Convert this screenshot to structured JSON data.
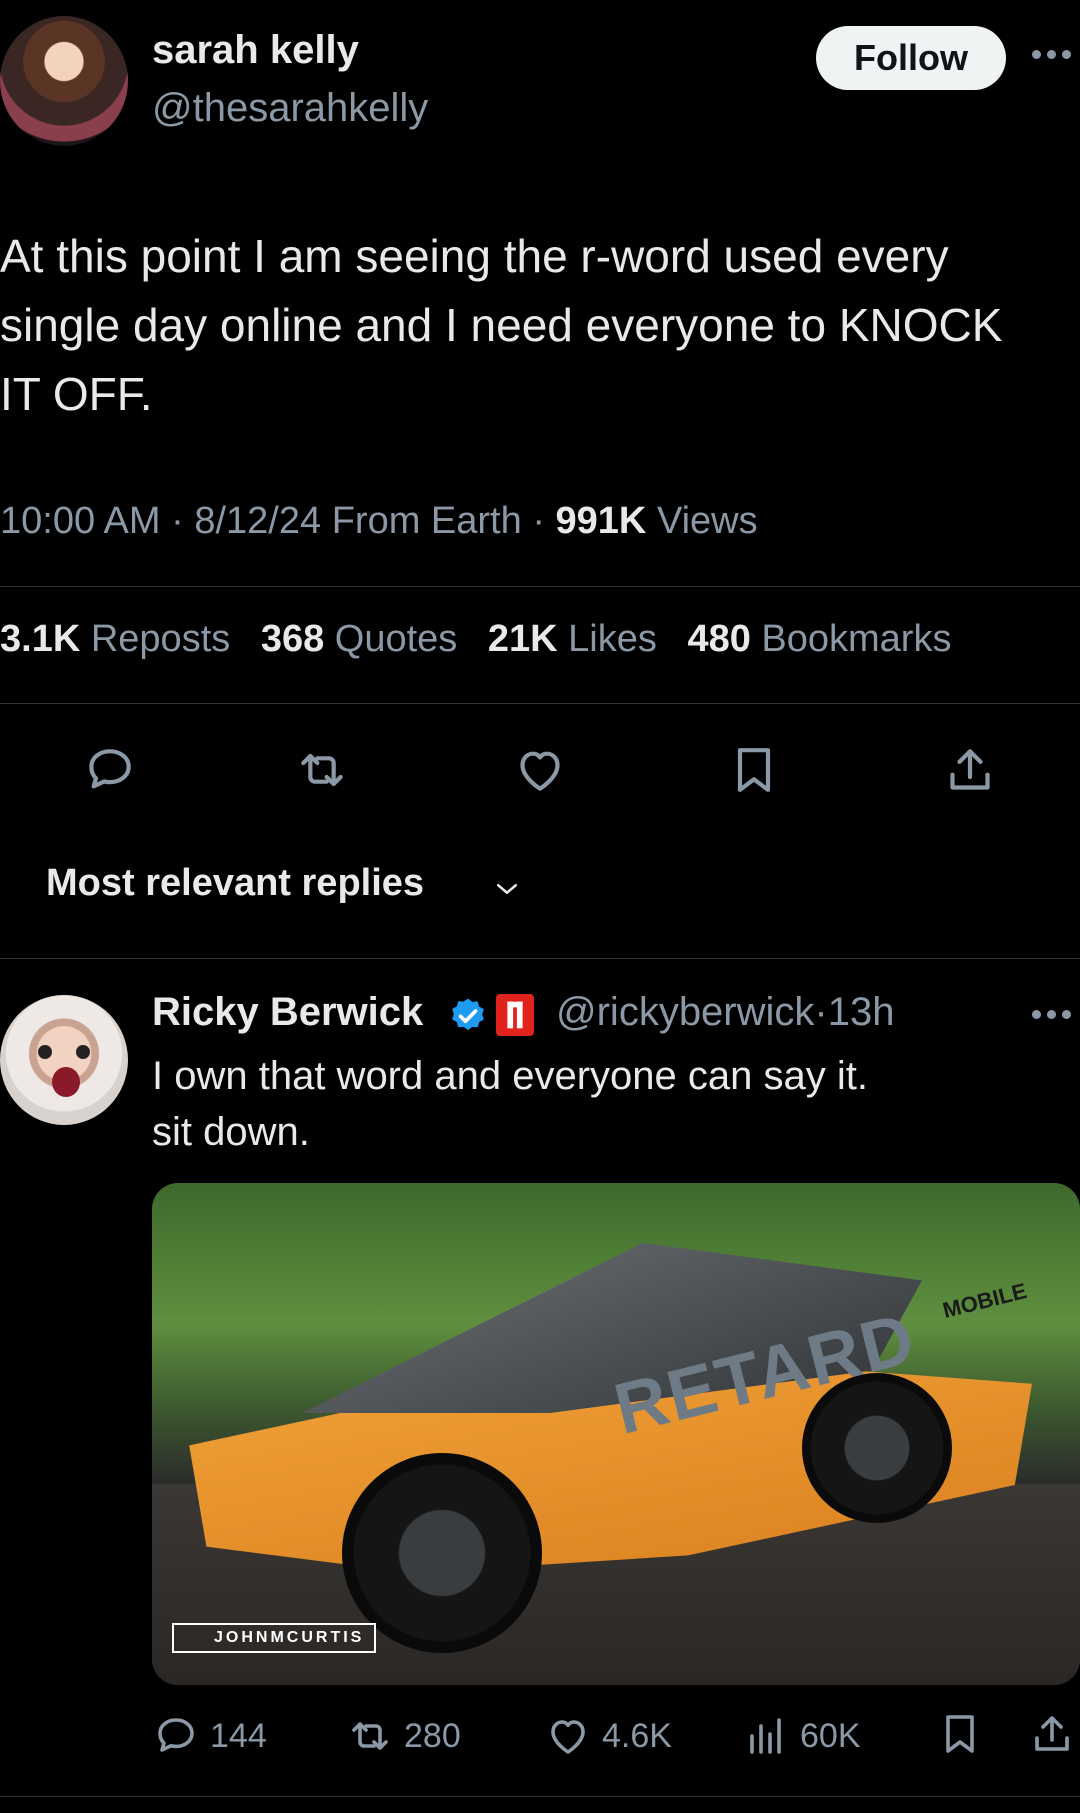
{
  "tweet": {
    "author": {
      "name": "sarah kelly",
      "handle": "@thesarahkelly"
    },
    "follow_label": "Follow",
    "text": "At this point I am seeing the r-word used every\nsingle day online and I need everyone to KNOCK\nIT OFF.",
    "meta": {
      "time": "10:00 AM",
      "date": "8/12/24",
      "source": "From Earth",
      "views_count": "991K",
      "views_label": "Views",
      "separator": "·"
    },
    "stats": [
      {
        "count": "3.1K",
        "label": "Reposts"
      },
      {
        "count": "368",
        "label": "Quotes"
      },
      {
        "count": "21K",
        "label": "Likes"
      },
      {
        "count": "480",
        "label": "Bookmarks"
      }
    ]
  },
  "replies_sort": {
    "label": "Most relevant replies"
  },
  "reply": {
    "author": {
      "name": "Ricky Berwick",
      "handle": "@rickyberwick",
      "time": "13h",
      "separator": "·"
    },
    "text": "I own that word and everyone can say it.\nsit down.",
    "media": {
      "wrap_text": "RETARD",
      "wrap_text_small": "MOBILE",
      "watermark": "JOHNMCURTIS"
    },
    "actions": {
      "replies": "144",
      "reposts": "280",
      "likes": "4.6K",
      "views": "60K"
    }
  },
  "colors": {
    "background": "#000000",
    "text": "#e7e9ea",
    "muted": "#8b98a5",
    "verified": "#1d9bf0",
    "divider": "#2f3336"
  }
}
